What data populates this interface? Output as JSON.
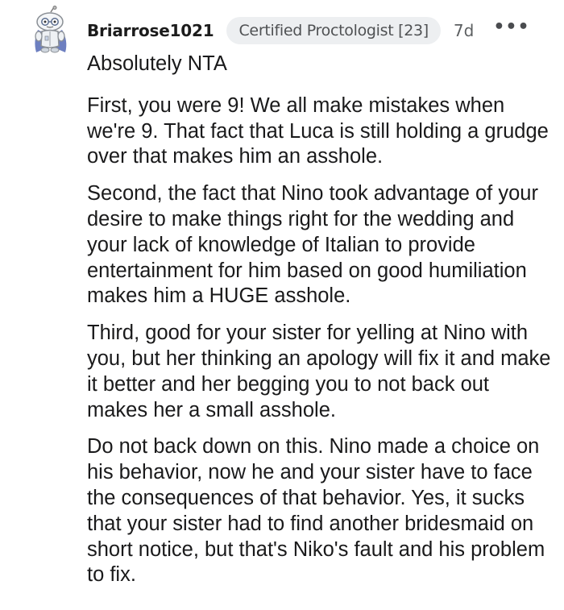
{
  "comment": {
    "author": "Briarrose1021",
    "flair": "Certified Proctologist [23]",
    "age": "7d",
    "more_label": "•••",
    "avatar_icon": "snoo-avatar-icon",
    "paragraphs": [
      "Absolutely NTA",
      "First, you were 9! We all make mistakes when we're 9. That fact that Luca is still holding a grudge over that makes him an asshole.",
      "Second, the fact that Nino took advantage of your desire to make things right for the wedding and your lack of knowledge of Italian to provide entertainment for him based on good humiliation makes him a HUGE asshole.",
      "Third, good for your sister for yelling at Nino with you, but her thinking an apology will fix it and make it better and her begging you to not back out makes her a small asshole.",
      "Do not back down on this. Nino made a choice on his behavior, now he and your sister have to face the consequences of that behavior. Yes, it sucks that your sister had to find another bridesmaid on short notice, but that's Niko's fault and his problem to fix."
    ]
  }
}
